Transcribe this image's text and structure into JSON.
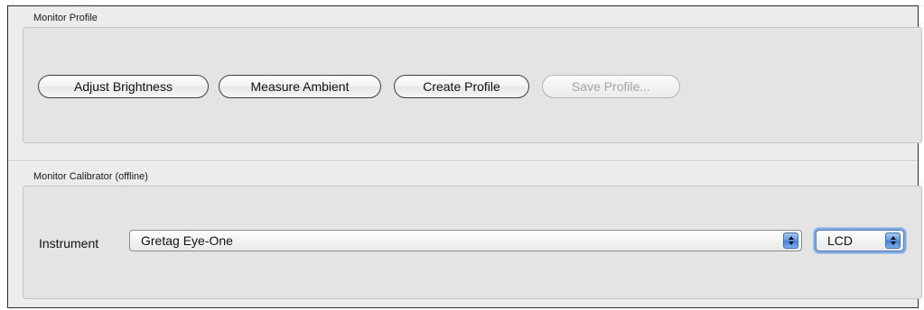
{
  "monitor_profile": {
    "title": "Monitor Profile",
    "buttons": {
      "adjust_brightness": "Adjust Brightness",
      "measure_ambient": "Measure Ambient",
      "create_profile": "Create Profile",
      "save_profile": "Save Profile..."
    }
  },
  "monitor_calibrator": {
    "title": "Monitor Calibrator (offline)",
    "instrument_label": "Instrument",
    "instrument_value": "Gretag Eye-One",
    "display_type_value": "LCD"
  },
  "icons": {
    "popup_arrows": "up-down-chevron-icon"
  },
  "colors": {
    "window_bg": "#ececec",
    "group_bg": "#e4e4e4",
    "accent_blue": "#5f97e1",
    "disabled_text": "#a4a4a4"
  },
  "states": {
    "save_profile_enabled": false,
    "display_type_focused": true
  }
}
